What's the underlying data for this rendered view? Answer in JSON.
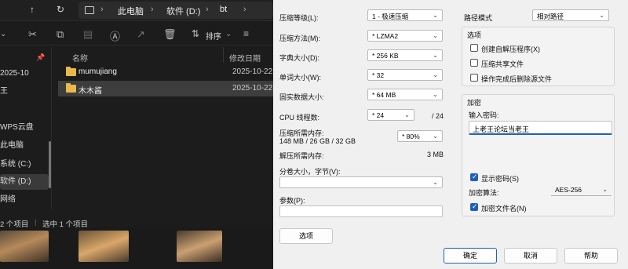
{
  "explorer": {
    "nav": {
      "up": "↑",
      "refresh": "↻"
    },
    "breadcrumb": [
      "此电脑",
      "软件 (D:)",
      "bt"
    ],
    "toolbar": {
      "sort_label": "排序",
      "view_label": "≡"
    },
    "sidebar": [
      {
        "label": "2025-10"
      },
      {
        "label": "王"
      },
      {
        "label": "WPS云盘"
      },
      {
        "label": "此电脑"
      },
      {
        "label": "系统 (C:)"
      },
      {
        "label": "软件 (D:)"
      },
      {
        "label": "网络"
      }
    ],
    "columns": {
      "name": "名称",
      "modified": "修改日期"
    },
    "rows": [
      {
        "name": "mumujiang",
        "date": "2025-10-22"
      },
      {
        "name": "木木酱",
        "date": "2025-10-22"
      }
    ],
    "status": {
      "count": "2 个项目",
      "selected": "选中 1 个项目"
    }
  },
  "dialog": {
    "level": {
      "label": "压缩等级(L):",
      "value": "1 - 极速压缩"
    },
    "method": {
      "label": "压缩方法(M):",
      "value": "* LZMA2"
    },
    "dict": {
      "label": "字典大小(D):",
      "value": "* 256 KB"
    },
    "word": {
      "label": "单词大小(W):",
      "value": "* 32"
    },
    "solid": {
      "label": "固实数据大小:",
      "value": "* 64 MB"
    },
    "cpu": {
      "label": "CPU 线程数:",
      "value": "* 24",
      "max": "/ 24"
    },
    "mem": {
      "label": "压缩所需内存:",
      "detail": "148 MB / 26 GB / 32 GB",
      "value": "* 80%"
    },
    "decomp": {
      "label": "解压所需内存:",
      "value": "3 MB"
    },
    "split": {
      "label": "分卷大小，字节(V):",
      "value": ""
    },
    "params": {
      "label": "参数(P):",
      "value": ""
    },
    "options_button": "选项",
    "path_mode": {
      "label": "路径模式",
      "value": "相对路径"
    },
    "options_group": {
      "title": "选项",
      "items": [
        {
          "label": "创建自解压程序(X)",
          "checked": false
        },
        {
          "label": "压缩共享文件",
          "checked": false
        },
        {
          "label": "操作完成后删除源文件",
          "checked": false
        }
      ]
    },
    "encryption": {
      "title": "加密",
      "password_label": "输入密码:",
      "password_value": "上老王论坛当老王",
      "show_password": {
        "label": "显示密码(S)",
        "checked": true
      },
      "method_label": "加密算法:",
      "method_value": "AES-256",
      "encrypt_names": {
        "label": "加密文件名(N)",
        "checked": true
      }
    },
    "buttons": {
      "ok": "确定",
      "cancel": "取消",
      "help": "帮助"
    }
  }
}
